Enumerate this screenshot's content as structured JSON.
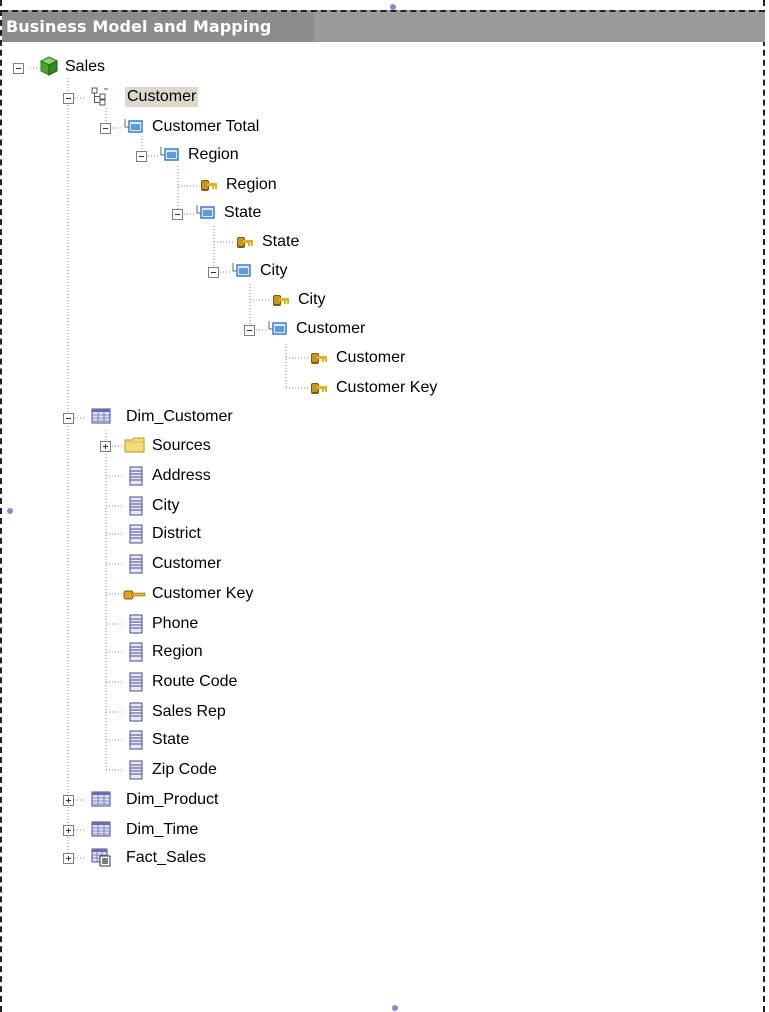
{
  "panel": {
    "title": "Business Model and Mapping"
  },
  "tree": {
    "root": "Sales",
    "customer_hierarchy": "Customer",
    "customer_total": "Customer Total",
    "region_level": "Region",
    "region_key": "Region",
    "state_level": "State",
    "state_key": "State",
    "city_level": "City",
    "city_key": "City",
    "customer_level": "Customer",
    "customer_key_1": "Customer",
    "customer_key_2": "Customer Key",
    "dim_customer": "Dim_Customer",
    "sources": "Sources",
    "columns": [
      "Address",
      "City",
      "District",
      "Customer",
      "Customer Key",
      "Phone",
      "Region",
      "Route Code",
      "Sales Rep",
      "State",
      "Zip Code"
    ],
    "dim_product": "Dim_Product",
    "dim_time": "Dim_Time",
    "fact_sales": "Fact_Sales"
  },
  "icons": {
    "root": "cube-icon",
    "hierarchy": "hierarchy-icon",
    "level": "level-icon",
    "key": "key-icon",
    "table": "table-icon",
    "folder": "folder-icon",
    "column": "column-icon",
    "fact_table": "fact-table-icon"
  },
  "colors": {
    "title_bar": "#9a9a9a",
    "selection": "#ddd8cc",
    "level_blue": "#3a7bd5",
    "key_gold": "#d4a017"
  }
}
